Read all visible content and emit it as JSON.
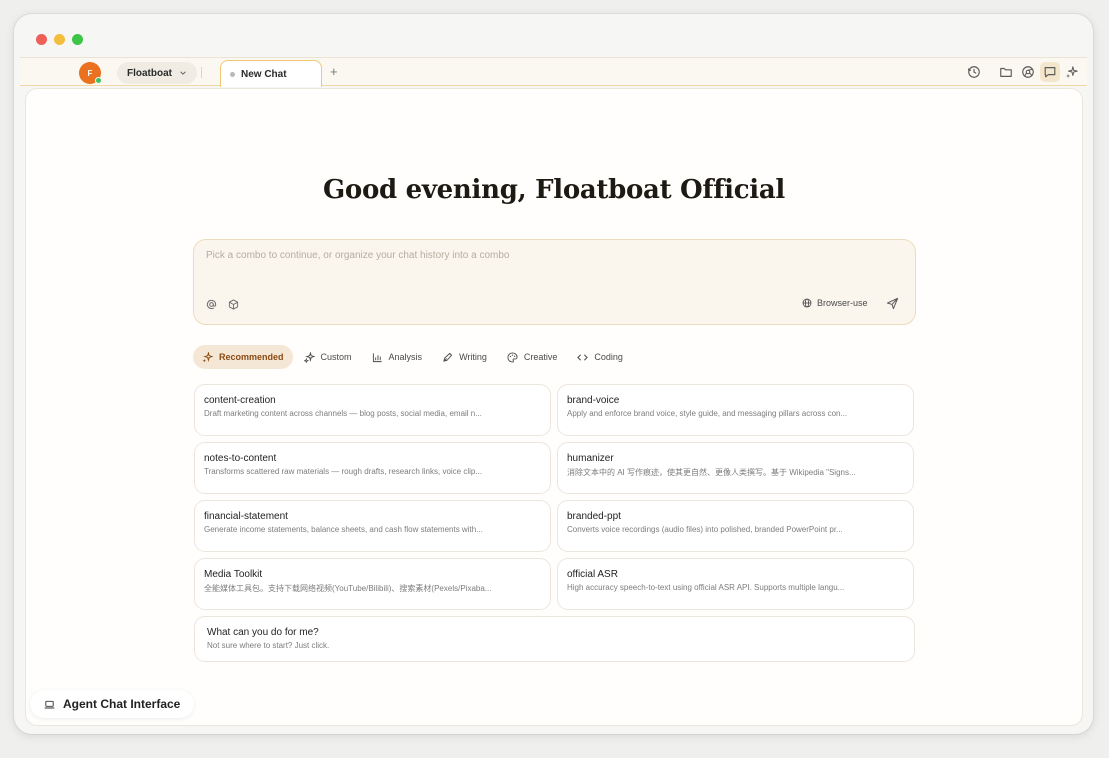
{
  "tabbar": {
    "avatar_letter": "F",
    "workspace_label": "Floatboat",
    "active_tab_label": "New Chat",
    "add_tab_symbol": "+",
    "right_icons": [
      "history-icon",
      "folder-icon",
      "browser-icon",
      "chat-icon",
      "sparkles-icon"
    ]
  },
  "main": {
    "greeting": "Good evening, Floatboat Official",
    "composer": {
      "placeholder": "Pick a combo to continue, or organize your chat history into a combo",
      "browser_use_label": "Browser-use"
    },
    "categories": [
      {
        "label": "Recommended",
        "icon": "sparkles-icon",
        "active": true
      },
      {
        "label": "Custom",
        "icon": "sparkles-icon",
        "active": false
      },
      {
        "label": "Analysis",
        "icon": "bar-chart-icon",
        "active": false
      },
      {
        "label": "Writing",
        "icon": "pen-icon",
        "active": false
      },
      {
        "label": "Creative",
        "icon": "palette-icon",
        "active": false
      },
      {
        "label": "Coding",
        "icon": "code-icon",
        "active": false
      }
    ],
    "cards": [
      {
        "title": "content-creation",
        "desc": "Draft marketing content across channels — blog posts, social media, email n..."
      },
      {
        "title": "brand-voice",
        "desc": "Apply and enforce brand voice, style guide, and messaging pillars across con..."
      },
      {
        "title": "notes-to-content",
        "desc": "Transforms scattered raw materials — rough drafts, research links, voice clip..."
      },
      {
        "title": "humanizer",
        "desc": "消除文本中的 AI 写作痕迹，使其更自然、更像人类撰写。基于 Wikipedia \"Signs..."
      },
      {
        "title": "financial-statement",
        "desc": "Generate income statements, balance sheets, and cash flow statements with..."
      },
      {
        "title": "branded-ppt",
        "desc": "Converts voice recordings (audio files) into polished, branded PowerPoint pr..."
      },
      {
        "title": "Media Toolkit",
        "desc": "全能媒体工具包。支持下载网络视频(YouTube/Bilibili)、搜索素材(Pexels/Pixaba..."
      },
      {
        "title": "official ASR",
        "desc": "High accuracy speech-to-text using official ASR API. Supports multiple langu..."
      }
    ],
    "help_card": {
      "title": "What can you do for me?",
      "desc": "Not sure where to start? Just click."
    }
  },
  "footer": {
    "label": "Agent Chat Interface"
  },
  "colors": {
    "accent": "#8a4b12",
    "avatar": "#e9711f",
    "tab_border": "#f0c873",
    "composer_bg": "#faf5ed"
  }
}
